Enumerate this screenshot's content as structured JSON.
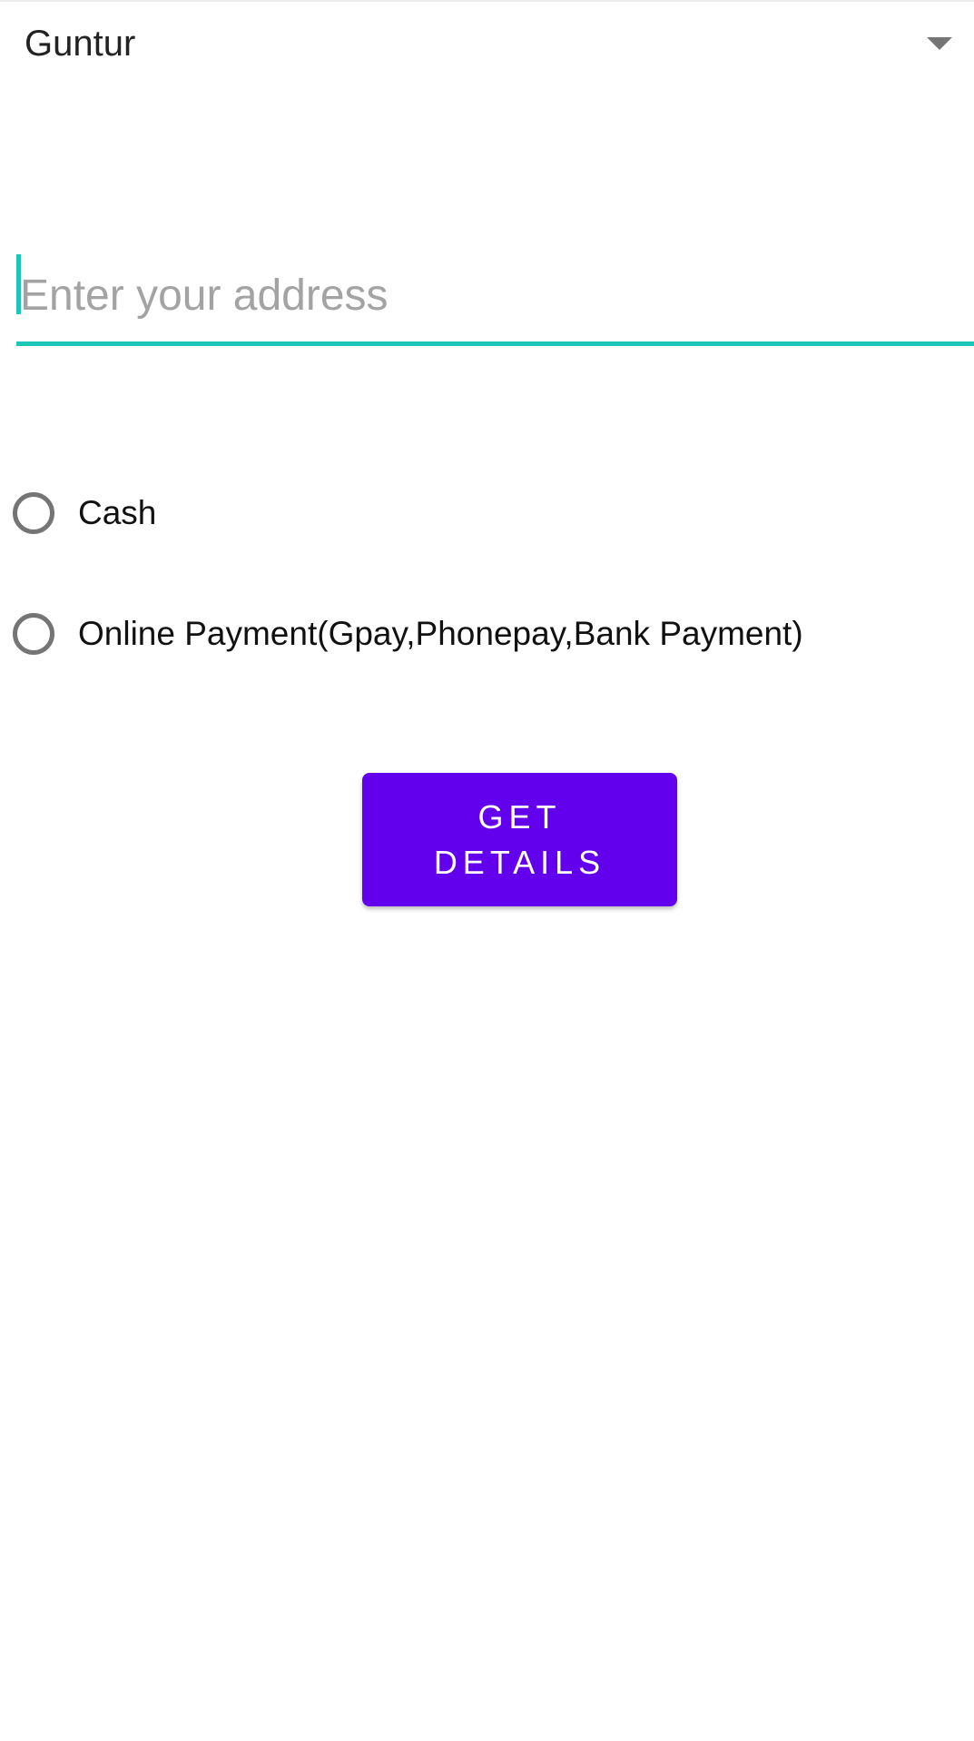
{
  "spinner": {
    "selected_value": "Guntur",
    "icon": "dropdown-arrow-icon"
  },
  "address": {
    "value": "",
    "placeholder": "Enter your address"
  },
  "payment": {
    "options": [
      {
        "label": "Cash",
        "checked": false
      },
      {
        "label": "Online Payment(Gpay,Phonepay,Bank Payment)",
        "checked": false
      }
    ]
  },
  "actions": {
    "get_details_label": "GET DETAILS"
  },
  "colors": {
    "accent": "#1dc7b8",
    "primary": "#6200ee",
    "radio_unchecked": "#757575"
  }
}
